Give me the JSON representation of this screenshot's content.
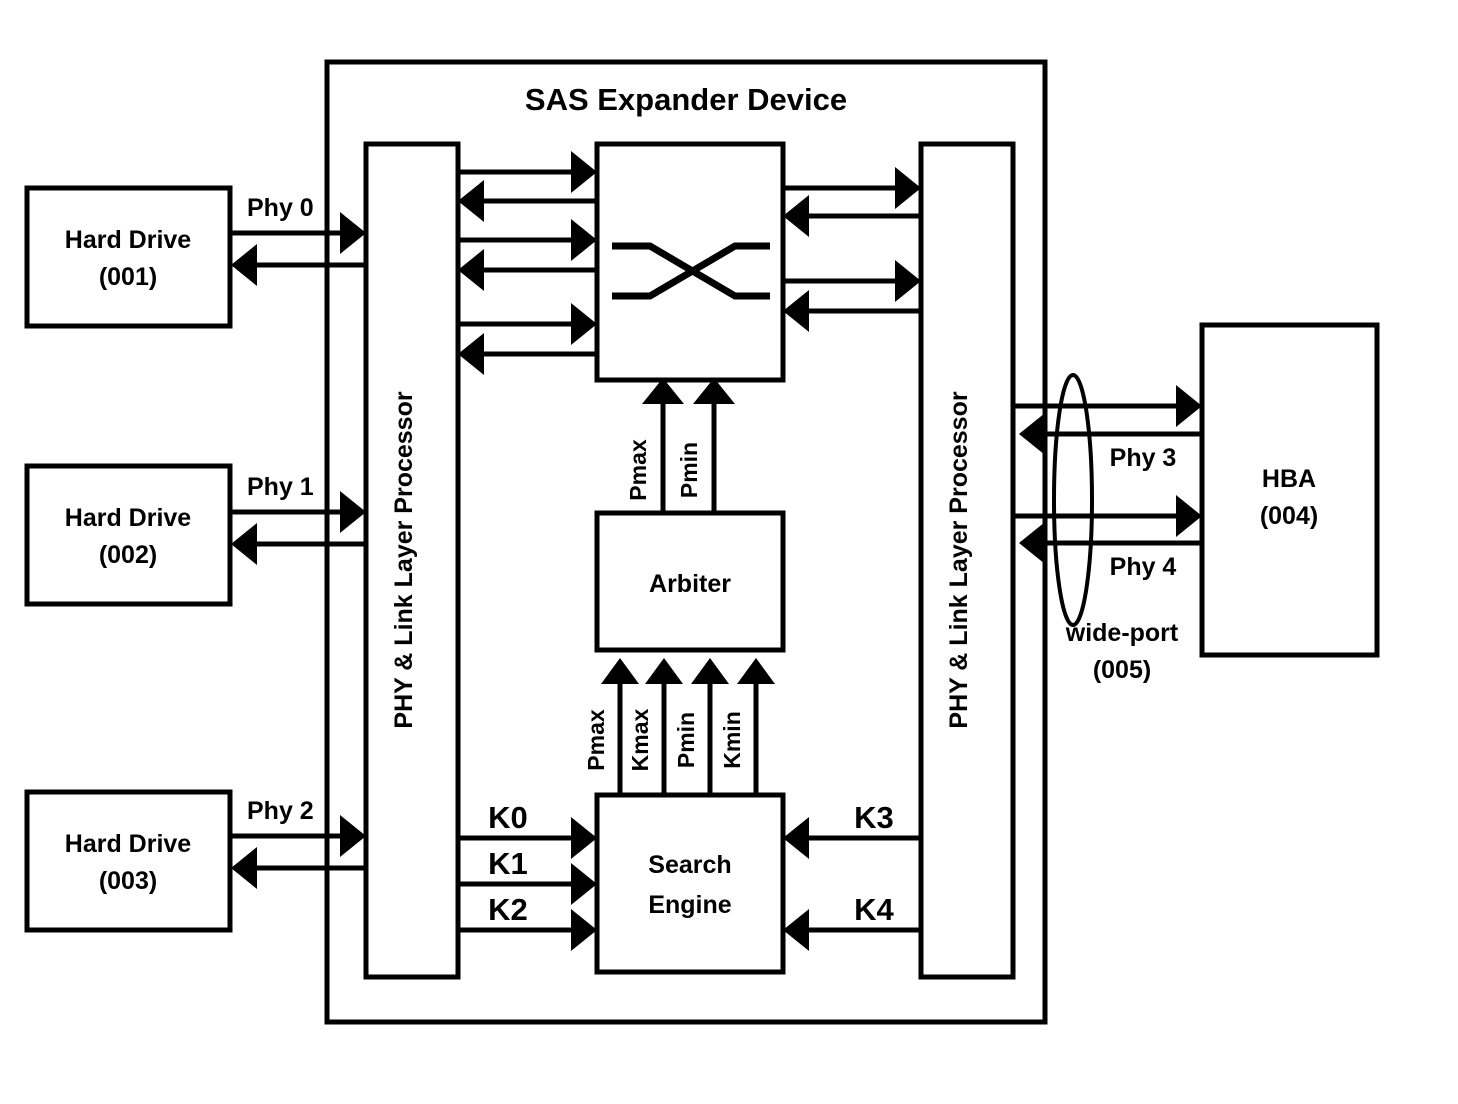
{
  "diagram": {
    "title": "SAS Expander Device",
    "left_devices": [
      {
        "name": "Hard Drive",
        "id": "(001)",
        "phy_label": "Phy 0"
      },
      {
        "name": "Hard Drive",
        "id": "(002)",
        "phy_label": "Phy 1"
      },
      {
        "name": "Hard Drive",
        "id": "(003)",
        "phy_label": "Phy 2"
      }
    ],
    "right_device": {
      "name": "HBA",
      "id": "(004)"
    },
    "wide_port": {
      "label": "wide-port",
      "id": "(005)",
      "phy_labels": [
        "Phy 3",
        "Phy 4"
      ]
    },
    "left_phy_processor": "PHY & Link Layer Processor",
    "right_phy_processor": "PHY & Link Layer Processor",
    "crossbar": {
      "label": "",
      "icon": "crossbar-x-icon"
    },
    "arbiter": {
      "label": "Arbiter"
    },
    "search_engine": {
      "line1": "Search",
      "line2": "Engine"
    },
    "arbiter_to_crossbar_signals": [
      "Pmax",
      "Pmin"
    ],
    "search_to_arbiter_signals": [
      "Pmax",
      "Kmax",
      "Pmin",
      "Kmin"
    ],
    "left_k_signals": [
      "K0",
      "K1",
      "K2"
    ],
    "right_k_signals": [
      "K3",
      "K4"
    ],
    "colors": {
      "stroke": "#000000",
      "fill": "#ffffff"
    }
  }
}
